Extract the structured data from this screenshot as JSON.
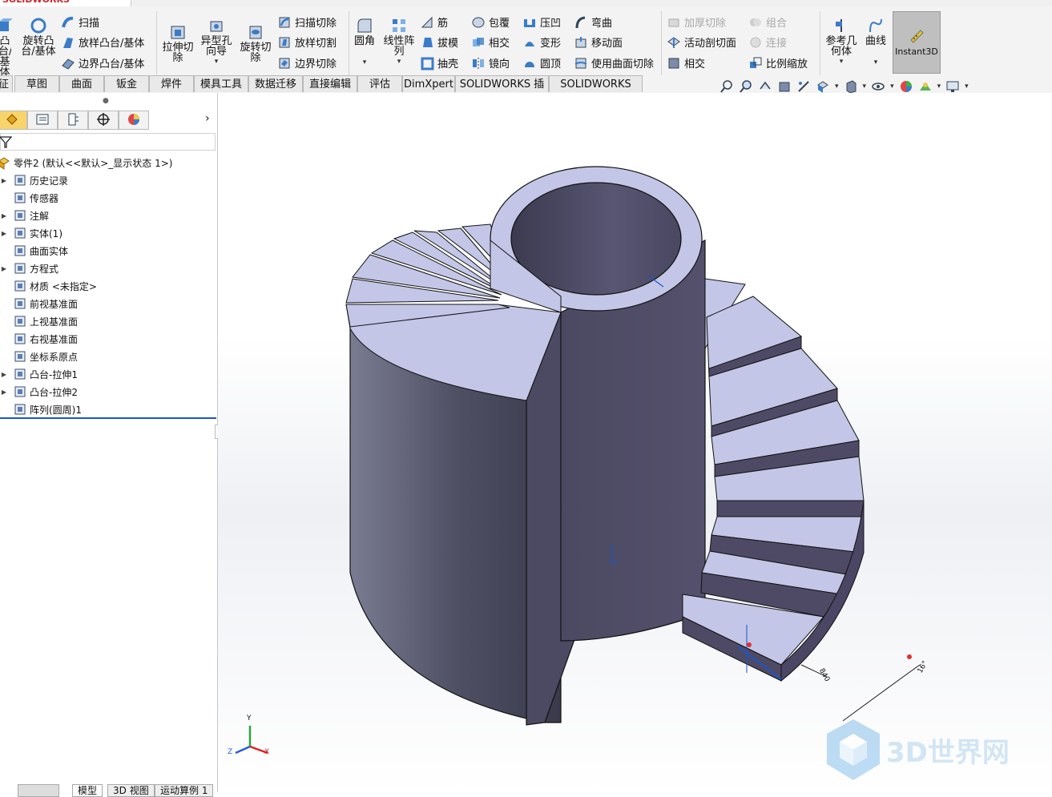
{
  "app": {
    "brand": "SOLIDWORKS"
  },
  "toolbar": {
    "col1": [
      "凸台/基体"
    ],
    "revolve_boss": "旋转凸台/基体",
    "sweep": "扫描",
    "loft_boss": "放样凸台/基体",
    "boundary_boss": "边界凸台/基体",
    "extruded_cut": "拉伸切除",
    "hole_wizard": "异型孔向导",
    "revolved_cut": "旋转切除",
    "swept_cut": "扫描切除",
    "lofted_cut": "放样切割",
    "boundary_cut": "边界切除",
    "fillet": "圆角",
    "linear_pattern": "线性阵列",
    "rib": "筋",
    "draft": "拔模",
    "shell": "抽壳",
    "wrap": "包覆",
    "intersect": "相交",
    "mirror": "镜向",
    "indent": "压凹",
    "deform": "变形",
    "dome": "圆顶",
    "flex": "弯曲",
    "move_face": "移动面",
    "cut_with_surface": "使用曲面切除",
    "thicken_cut": "加厚切除",
    "live_section": "活动剖切面",
    "intersect2": "相交",
    "combine": "组合",
    "join": "连接",
    "scale": "比例缩放",
    "ref_geometry": "参考几何体",
    "curves": "曲线",
    "instant3d": "Instant3D"
  },
  "command_tabs": [
    "特征",
    "草图",
    "曲面",
    "钣金",
    "焊件",
    "模具工具",
    "数据迁移",
    "直接编辑",
    "评估",
    "DimXpert",
    "SOLIDWORKS 插件",
    "SOLIDWORKS MBD"
  ],
  "tree": {
    "root": "零件2  (默认<<默认>_显示状态 1>)",
    "items": [
      {
        "label": "历史记录",
        "arrow": true
      },
      {
        "label": "传感器",
        "arrow": false
      },
      {
        "label": "注解",
        "arrow": true
      },
      {
        "label": "实体(1)",
        "arrow": true
      },
      {
        "label": "曲面实体",
        "arrow": false
      },
      {
        "label": "方程式",
        "arrow": true
      },
      {
        "label": "材质 <未指定>",
        "arrow": false
      },
      {
        "label": "前视基准面",
        "arrow": false
      },
      {
        "label": "上视基准面",
        "arrow": false
      },
      {
        "label": "右视基准面",
        "arrow": false
      },
      {
        "label": "坐标系原点",
        "arrow": false
      },
      {
        "label": "凸台-拉伸1",
        "arrow": true
      },
      {
        "label": "凸台-拉伸2",
        "arrow": true
      },
      {
        "label": "阵列(圆周)1",
        "arrow": false
      }
    ]
  },
  "viewport": {
    "dimension_1": "16°",
    "dimension_2": "840",
    "triad": {
      "x": "X",
      "y": "Y",
      "z": "Z"
    },
    "watermark": "3D世界网"
  },
  "bottom_tabs": [
    "模型",
    "3D 视图",
    "运动算例 1"
  ],
  "colors": {
    "face_light": "#c3c6e6",
    "face_dark": "#4e4a66",
    "accent": "#1a56c8"
  }
}
